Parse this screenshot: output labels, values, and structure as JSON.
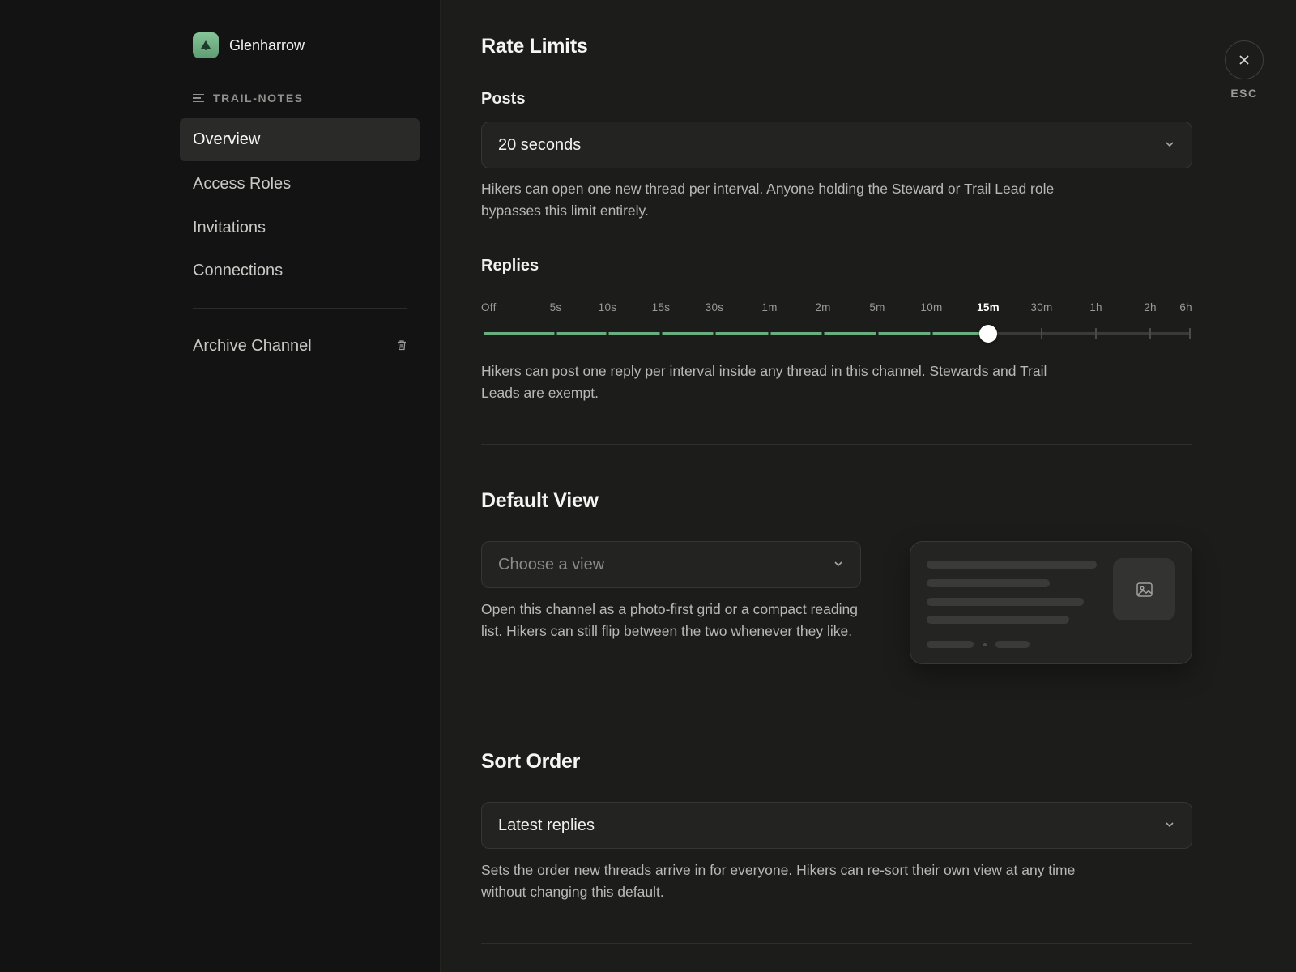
{
  "workspace": {
    "name": "Glenharrow"
  },
  "sidebar": {
    "section_label": "TRAIL-NOTES",
    "items": [
      {
        "label": "Overview",
        "active": true
      },
      {
        "label": "Access Roles",
        "active": false
      },
      {
        "label": "Invitations",
        "active": false
      },
      {
        "label": "Connections",
        "active": false
      }
    ],
    "archive_label": "Archive Channel"
  },
  "esc": {
    "label": "ESC"
  },
  "rate_limits": {
    "title": "Rate Limits",
    "posts": {
      "label": "Posts",
      "value": "20 seconds",
      "description": "Hikers can open one new thread per interval. Anyone holding the Steward or Trail Lead role bypasses this limit entirely."
    },
    "replies": {
      "label": "Replies",
      "ticks": [
        "Off",
        "5s",
        "10s",
        "15s",
        "30s",
        "1m",
        "2m",
        "5m",
        "10m",
        "15m",
        "30m",
        "1h",
        "2h",
        "6h"
      ],
      "selected": "15m",
      "description": "Hikers can post one reply per interval inside any thread in this channel. Stewards and Trail Leads are exempt."
    }
  },
  "default_view": {
    "title": "Default View",
    "placeholder": "Choose a view",
    "description": "Open this channel as a photo-first grid or a compact reading list. Hikers can still flip between the two whenever they like."
  },
  "sort_order": {
    "title": "Sort Order",
    "value": "Latest replies",
    "description": "Sets the order new threads arrive in for everyone. Hikers can re-sort their own view at any time without changing this default."
  },
  "colors": {
    "accent": "#6aad7e",
    "background": "#1c1c1b",
    "sidebar": "#131313"
  }
}
